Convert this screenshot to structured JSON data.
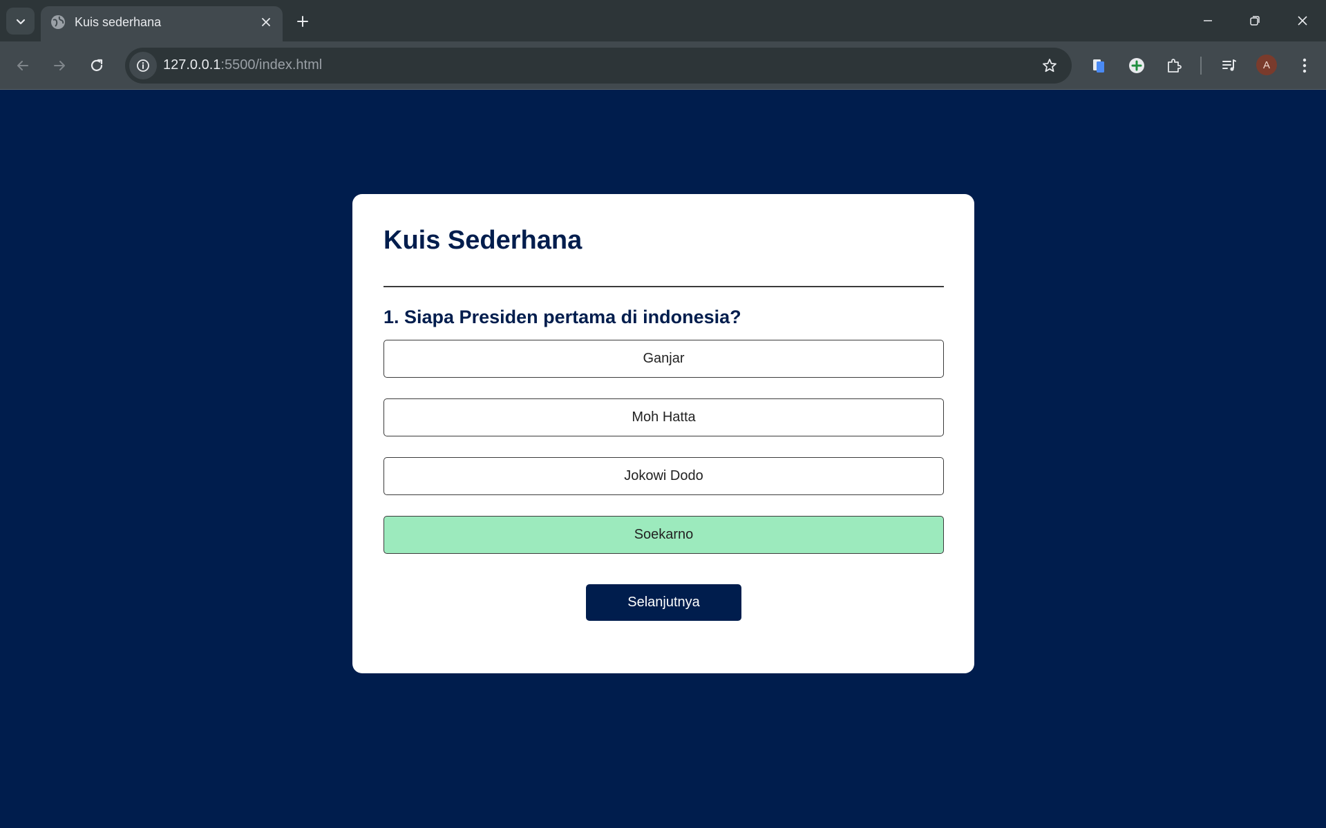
{
  "browser": {
    "tab": {
      "title": "Kuis sederhana"
    },
    "address": {
      "host": "127.0.0.1",
      "rest": ":5500/index.html"
    },
    "profile_initial": "A"
  },
  "quiz": {
    "title": "Kuis Sederhana",
    "question": "1. Siapa Presiden pertama di indonesia?",
    "answers": [
      {
        "label": "Ganjar",
        "state": "default"
      },
      {
        "label": "Moh Hatta",
        "state": "default"
      },
      {
        "label": "Jokowi Dodo",
        "state": "default"
      },
      {
        "label": "Soekarno",
        "state": "correct"
      }
    ],
    "next_label": "Selanjutnya"
  },
  "colors": {
    "page_bg": "#001d4d",
    "correct_bg": "#9ceabd",
    "accent": "#001d4d"
  }
}
